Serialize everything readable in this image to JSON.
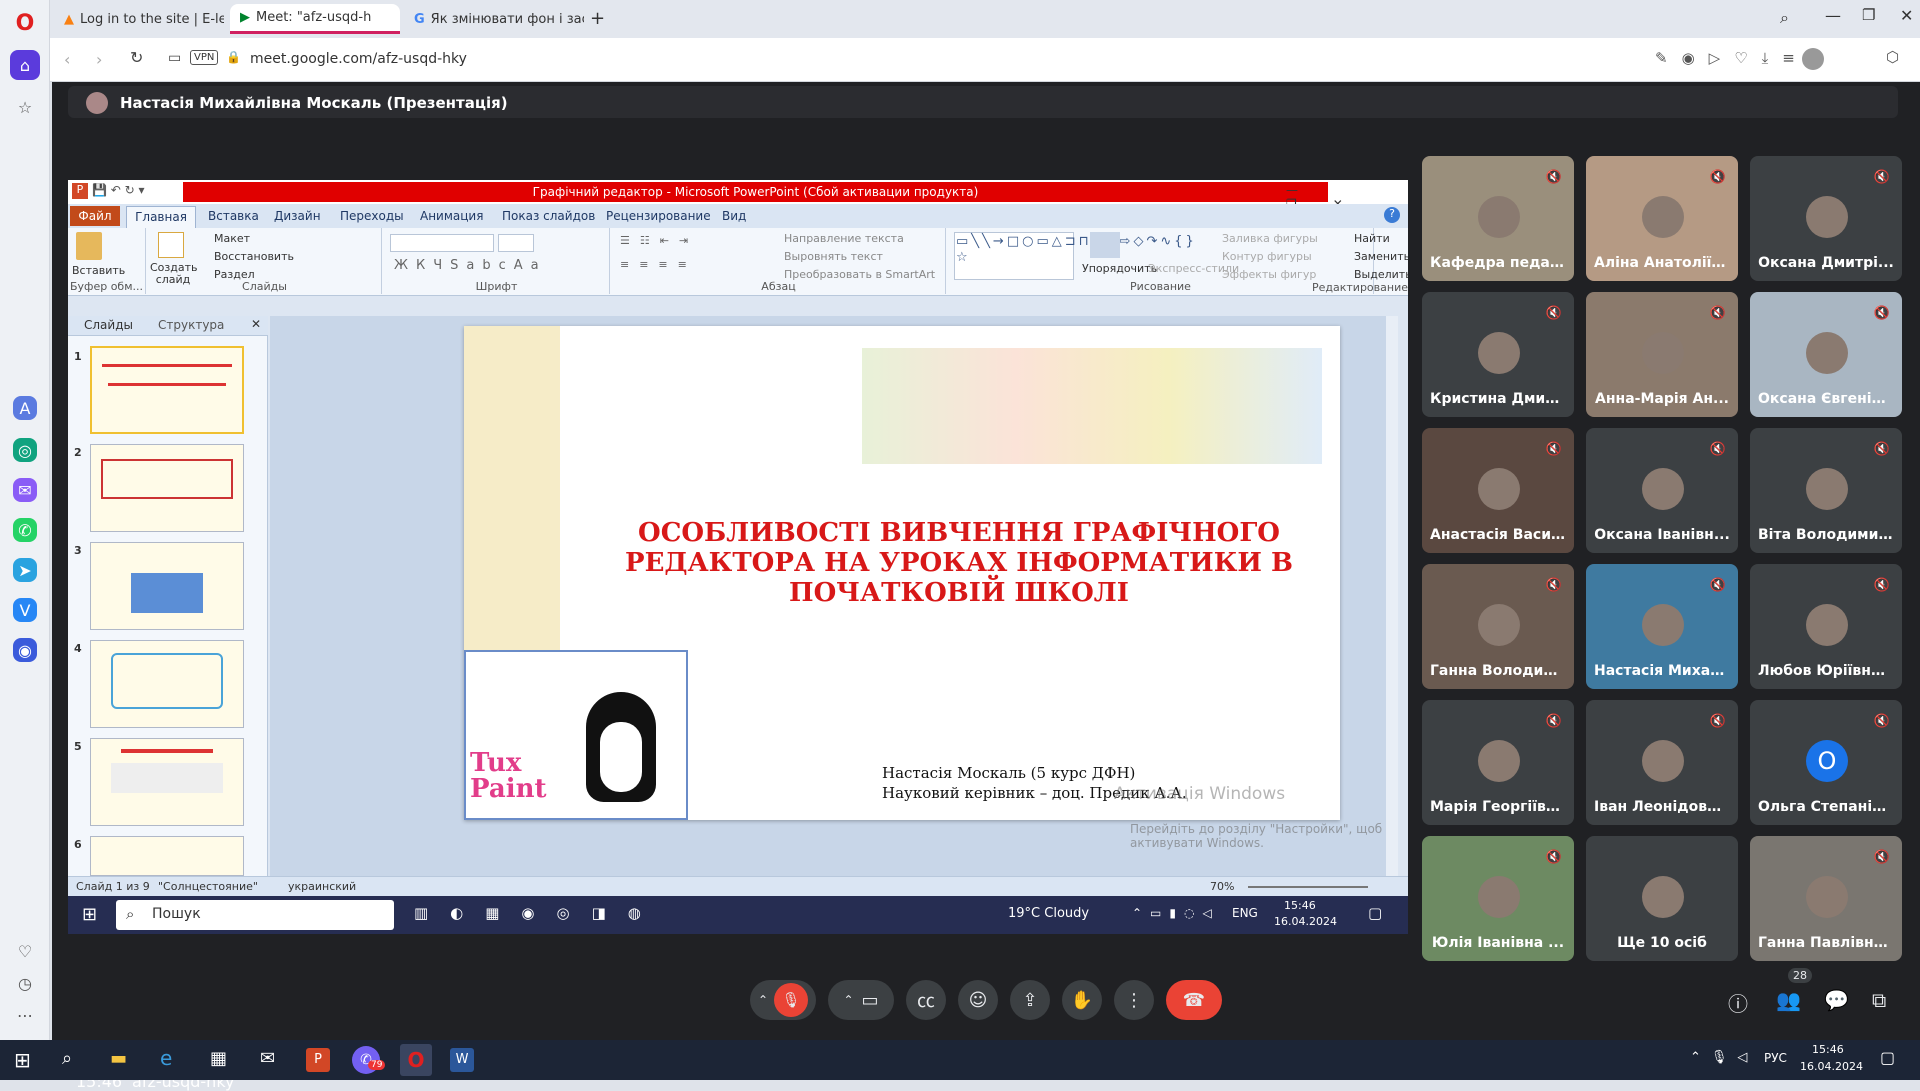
{
  "browser": {
    "tabs": [
      {
        "label": "Log in to the site | E-learn",
        "icon": "moodle-icon"
      },
      {
        "label": "Meet: \"afz-usqd-h",
        "icon": "meet-icon"
      },
      {
        "label": "Як змінювати фон і засто",
        "icon": "google-icon"
      }
    ],
    "url": "meet.google.com/afz-usqd-hky",
    "vpn_label": "VPN"
  },
  "meet": {
    "presenter_title": "Настасія Михайлівна Москаль (Презентація)",
    "time": "15:46",
    "meeting_code": "afz-usqd-hky",
    "participants_count": "28",
    "participants": [
      {
        "name": "Кафедра педаг...",
        "color": "#9a8f7c"
      },
      {
        "name": "Аліна Анатоліїв...",
        "color": "#b59a84"
      },
      {
        "name": "Оксана Дмитрі...",
        "color": "#3c4043"
      },
      {
        "name": "Кристина Дмит...",
        "color": "#3c4043"
      },
      {
        "name": "Анна-Марія Ан...",
        "color": "#8b7a6c"
      },
      {
        "name": "Оксана Євгенів...",
        "color": "#a9b6c2"
      },
      {
        "name": "Анастасія Васи...",
        "color": "#5a4840"
      },
      {
        "name": "Оксана Іванівн...",
        "color": "#3c4043"
      },
      {
        "name": "Віта Володими...",
        "color": "#3c4043"
      },
      {
        "name": "Ганна Володим...",
        "color": "#6a5a50"
      },
      {
        "name": "Настасія Михай...",
        "color": "#3f7aa0"
      },
      {
        "name": "Любов Юріївна ...",
        "color": "#3c4043"
      },
      {
        "name": "Марія Георгіївн...",
        "color": "#3c4043"
      },
      {
        "name": "Іван Леонідови...",
        "color": "#3c4043"
      },
      {
        "name": "Ольга Степанів...",
        "color": "#3c4043"
      },
      {
        "name": "Юлія Іванівна ...",
        "color": "#6d8a62"
      },
      {
        "name": "Ще 10 осіб",
        "color": "#3c4043"
      },
      {
        "name": "Ганна Павлівна ...",
        "color": "#7a7670"
      }
    ],
    "avatar_letter": "О"
  },
  "ppt": {
    "title": "Графічний редактор - Microsoft PowerPoint (Сбой активации продукта)",
    "tabs": [
      "Файл",
      "Главная",
      "Вставка",
      "Дизайн",
      "Переходы",
      "Анимация",
      "Показ слайдов",
      "Рецензирование",
      "Вид"
    ],
    "groups": {
      "clipboard": "Буфер обм...",
      "slides": "Слайды",
      "font": "Шрифт",
      "paragraph": "Абзац",
      "drawing": "Рисование",
      "editing": "Редактирование"
    },
    "buttons": {
      "paste": "Вставить",
      "new_slide": "Создать слайд",
      "layout": "Макет",
      "reset": "Восстановить",
      "section": "Раздел",
      "text_direction": "Направление текста",
      "align_text": "Выровнять текст",
      "smartart": "Преобразовать в SmartArt",
      "arrange": "Упорядочить",
      "quick_styles": "Экспресс-стили",
      "fill": "Заливка фигуры",
      "outline": "Контур фигуры",
      "effects": "Эффекты фигур",
      "find": "Найти",
      "replace": "Заменить",
      "select": "Выделить"
    },
    "panel_tabs": [
      "Слайды",
      "Структура"
    ],
    "slide_numbers": [
      "1",
      "2",
      "3",
      "4",
      "5",
      "6"
    ],
    "slide_title": "ОСОБЛИВОСТІ ВИВЧЕННЯ ГРАФІЧНОГО РЕДАКТОРА НА УРОКАХ ІНФОРМАТИКИ В ПОЧАТКОВІЙ ШКОЛІ",
    "author_line1": "Настасія Москаль (5 курс ДФН)",
    "author_line2": "Науковий керівник – доц. Предик А.А.",
    "tux_label": "Tux Paint",
    "watermark1": "Активація Windows",
    "watermark2": "Перейдіть до розділу \"Настройки\", щоб активувати Windows.",
    "status": {
      "slide": "Слайд 1 из 9",
      "theme": "\"Солнцестояние\"",
      "lang": "украинский",
      "zoom": "70%"
    }
  },
  "inner_taskbar": {
    "search": "Пошук",
    "weather": "19°C  Cloudy",
    "lang": "ENG",
    "time": "15:46",
    "date": "16.04.2024"
  },
  "taskbar": {
    "lang": "РУС",
    "time": "15:46",
    "date": "16.04.2024",
    "viber_badge": "79"
  }
}
